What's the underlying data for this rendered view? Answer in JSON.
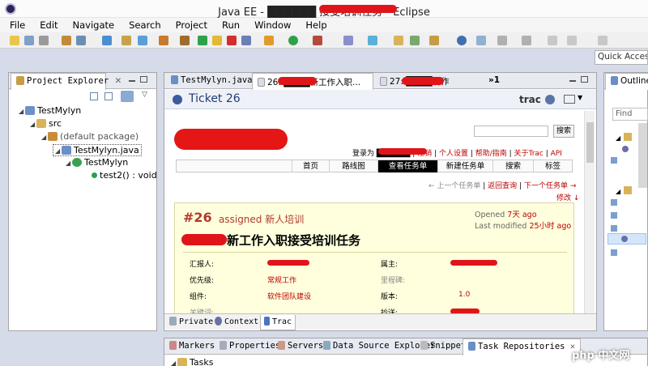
{
  "window": {
    "title": "Java EE - ██████ 接受培训任务 - Eclipse"
  },
  "menu": [
    "File",
    "Edit",
    "Navigate",
    "Search",
    "Project",
    "Run",
    "Window",
    "Help"
  ],
  "quick_access": {
    "placeholder": "Quick Access"
  },
  "project_explorer": {
    "tab_label": "Project Explorer",
    "items": [
      {
        "label": "TestMylyn"
      },
      {
        "label": "src"
      },
      {
        "label": "(default package)"
      },
      {
        "label": "TestMylyn.java"
      },
      {
        "label": "TestMylyn"
      },
      {
        "label": "test2() : void"
      }
    ]
  },
  "editor": {
    "tabs": [
      {
        "label": "TestMylyn.java"
      },
      {
        "label": "26: ████新工作入职..."
      },
      {
        "label": "27: ████制作"
      },
      {
        "label": "»1"
      }
    ],
    "ticket_header": {
      "title": "Ticket 26",
      "connector": "trac"
    },
    "trac": {
      "search_button": "搜索",
      "meta_links": [
        "登录为 ██████",
        "注销",
        "个人设置",
        "帮助/指南",
        "关于Trac",
        "API"
      ],
      "nav": [
        "首页",
        "路线图",
        "查看任务单",
        "新建任务单",
        "搜索",
        "标签"
      ],
      "nav_active_index": 2,
      "prev_link": "← 上一个任务单",
      "back_link": "返回查询",
      "next_link": "下一个任务单 →",
      "modify_link": "修改 ↓",
      "ticket": {
        "number": "#26",
        "status": "assigned 新人培训",
        "opened_label": "Opened",
        "opened_value": "7天 ago",
        "modified_label": "Last modified",
        "modified_value": "25小时 ago",
        "summary": "新工作入职接受培训任务",
        "fields": [
          {
            "label": "汇报人:",
            "value": "████",
            "label2": "属主:",
            "value2": "████"
          },
          {
            "label": "优先级:",
            "value": "常规工作",
            "label2": "里程碑:",
            "value2": ""
          },
          {
            "label": "组件:",
            "value": "软件团队建设",
            "label2": "版本:",
            "value2": "1.0"
          },
          {
            "label": "关键词:",
            "value": "",
            "label2": "抄送:",
            "value2": "████"
          }
        ]
      }
    },
    "bottom_tabs": [
      "Private",
      "Context",
      "Trac"
    ]
  },
  "outline": {
    "tab_label": "Outline",
    "find_placeholder": "Find"
  },
  "bottom_panel": {
    "tabs": [
      "Markers",
      "Properties",
      "Servers",
      "Data Source Explorer",
      "Snippets",
      "Task Repositories"
    ],
    "tree_item": "Tasks"
  },
  "watermark": {
    "text": "php 中文网"
  }
}
